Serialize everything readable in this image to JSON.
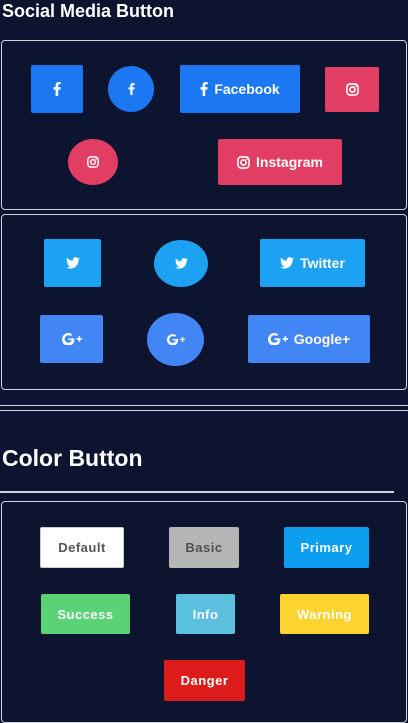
{
  "headings": {
    "social": "Social Media Button",
    "color": "Color Button"
  },
  "social": {
    "facebook_label": "Facebook",
    "instagram_label": "Instagram",
    "twitter_label": "Twitter",
    "googleplus_label": "Google+",
    "colors": {
      "facebook": "#1c77f2",
      "instagram": "#e23e63",
      "twitter": "#1da1f2",
      "googleplus": "#4285f4"
    },
    "icons": [
      "facebook-icon",
      "instagram-icon",
      "twitter-icon",
      "google-plus-icon"
    ]
  },
  "color_buttons": {
    "default": "Default",
    "basic": "Basic",
    "primary": "Primary",
    "success": "Success",
    "info": "Info",
    "warning": "Warning",
    "danger": "Danger",
    "colors": {
      "default": "#ffffff",
      "basic": "#b5b5b5",
      "primary": "#0d9ef0",
      "success": "#5ad276",
      "info": "#5bc0de",
      "warning": "#fdd330",
      "danger": "#de1b1b"
    }
  },
  "page": {
    "background": "#0d1430"
  }
}
